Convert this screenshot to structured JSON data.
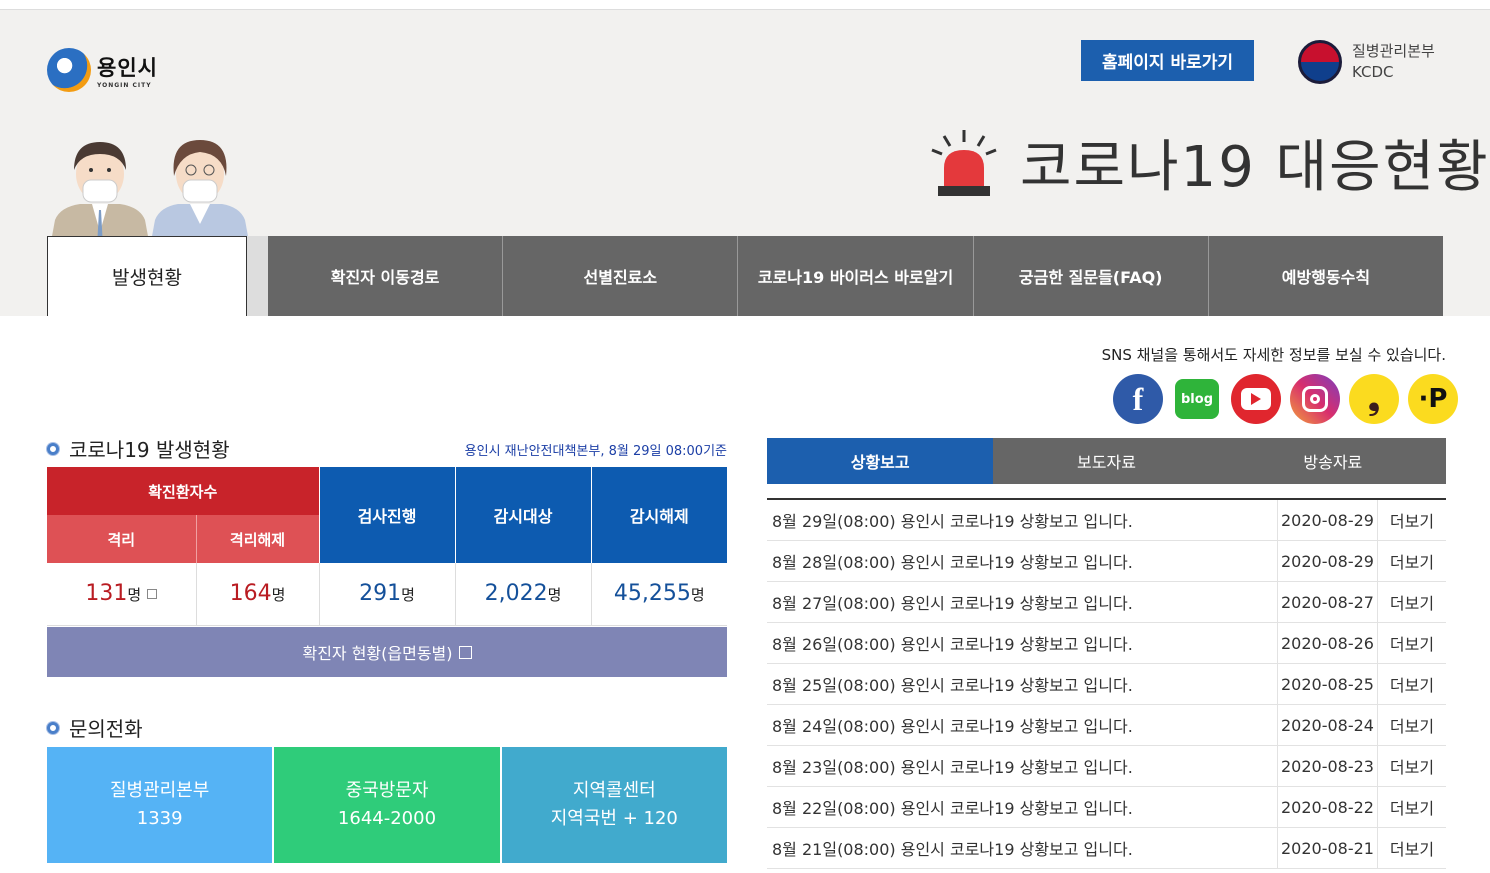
{
  "header": {
    "logo_name": "용인시",
    "logo_sub": "YONGIN CITY",
    "home_button": "홈페이지 바로가기",
    "kcdc_line1": "질병관리본부",
    "kcdc_line2": "KCDC",
    "title": "코로나19  대응현황"
  },
  "nav": {
    "tabs": [
      "발생현황",
      "확진자 이동경로",
      "선별진료소",
      "코로나19 바이러스 바로알기",
      "궁금한 질문들(FAQ)",
      "예방행동수칙"
    ]
  },
  "sns": {
    "text": "SNS 채널을 통해서도 자세한 정보를 보실 수 있습니다.",
    "icons": [
      "facebook-icon",
      "blog-icon",
      "youtube-icon",
      "instagram-icon",
      "kakao-icon",
      "post-icon"
    ],
    "blog_label": "blog"
  },
  "stats": {
    "title": "코로나19 발생현황",
    "date_note": "용인시 재난안전대책본부, 8월 29일 08:00기준",
    "headers": {
      "confirmed": "확진환자수",
      "isolated": "격리",
      "released": "격리해제",
      "testing": "검사진행",
      "monitoring": "감시대상",
      "monitor_released": "감시해제"
    },
    "values": {
      "isolated": "131",
      "released": "164",
      "testing": "291",
      "monitoring": "2,022",
      "monitor_released": "45,255"
    },
    "unit": "명",
    "status_button": "확진자 현황(읍면동별)"
  },
  "contacts": {
    "title": "문의전화",
    "items": [
      {
        "name": "질병관리본부",
        "number": "1339",
        "color": "#55b3f5"
      },
      {
        "name": "중국방문자",
        "number": "1644-2000",
        "color": "#2fcc7a"
      },
      {
        "name": "지역콜센터",
        "number": "지역국번 + 120",
        "color": "#41aacd"
      }
    ]
  },
  "reports": {
    "tabs": [
      "상황보고",
      "보도자료",
      "방송자료"
    ],
    "more_label": "더보기",
    "rows": [
      {
        "title": "8월 29일(08:00) 용인시 코로나19 상황보고 입니다.",
        "date": "2020-08-29"
      },
      {
        "title": "8월 28일(08:00) 용인시 코로나19 상황보고 입니다.",
        "date": "2020-08-29"
      },
      {
        "title": "8월 27일(08:00) 용인시 코로나19 상황보고 입니다.",
        "date": "2020-08-27"
      },
      {
        "title": "8월 26일(08:00) 용인시 코로나19 상황보고 입니다.",
        "date": "2020-08-26"
      },
      {
        "title": "8월 25일(08:00) 용인시 코로나19 상황보고 입니다.",
        "date": "2020-08-25"
      },
      {
        "title": "8월 24일(08:00) 용인시 코로나19 상황보고 입니다.",
        "date": "2020-08-24"
      },
      {
        "title": "8월 23일(08:00) 용인시 코로나19 상황보고 입니다.",
        "date": "2020-08-23"
      },
      {
        "title": "8월 22일(08:00) 용인시 코로나19 상황보고 입니다.",
        "date": "2020-08-22"
      },
      {
        "title": "8월 21일(08:00) 용인시 코로나19 상황보고 입니다.",
        "date": "2020-08-21"
      }
    ]
  }
}
